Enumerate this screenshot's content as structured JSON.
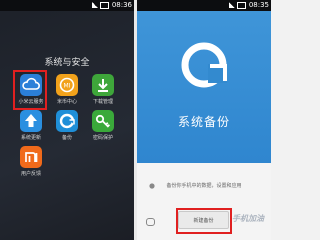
{
  "left": {
    "status_time": "08:36",
    "folder_title": "系统与安全",
    "apps": [
      {
        "label": "小米云服务",
        "icon": "cloud-icon",
        "color": "#2b7fd8"
      },
      {
        "label": "米币中心",
        "icon": "mi-coin-icon",
        "color": "#f2a21b"
      },
      {
        "label": "下载管理",
        "icon": "download-icon",
        "color": "#3ea63a"
      },
      {
        "label": "系统更新",
        "icon": "update-arrow-icon",
        "color": "#2a8fe0"
      },
      {
        "label": "备份",
        "icon": "backup-icon",
        "color": "#1f8fd8"
      },
      {
        "label": "密码保护",
        "icon": "key-icon",
        "color": "#3aa93a"
      },
      {
        "label": "用户反馈",
        "icon": "mi-logo-icon",
        "color": "#f06a1b"
      }
    ]
  },
  "right": {
    "status_time": "08:35",
    "title": "系统备份",
    "description": "备份你手机中的数据，设置和应用",
    "button_label": "新建备份",
    "watermark": "手机加油"
  }
}
